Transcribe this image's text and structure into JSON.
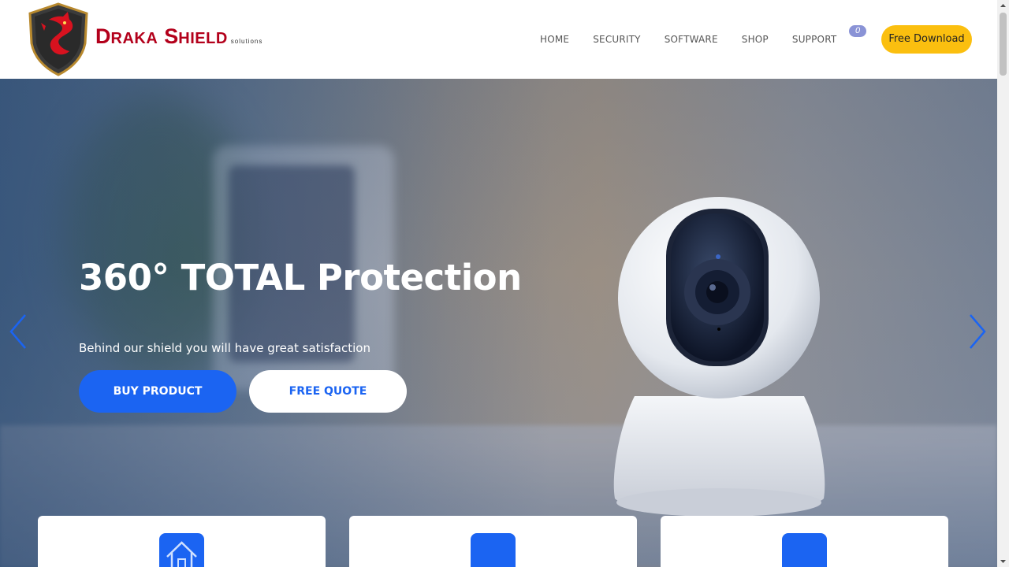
{
  "brand": {
    "first_initial": "D",
    "first_rest": "RAKA",
    "second_initial": "S",
    "second_rest": "HIELD",
    "suffix": "solutions"
  },
  "nav": {
    "items": [
      {
        "label": "HOME"
      },
      {
        "label": "SECURITY"
      },
      {
        "label": "SOFTWARE"
      },
      {
        "label": "SHOP"
      },
      {
        "label": "SUPPORT"
      }
    ],
    "cart_count": "0",
    "download_label": "Free Download"
  },
  "hero": {
    "headline": "360° TOTAL Protection",
    "tagline": "Behind our shield you will have great satisfaction",
    "buy_label": "BUY PRODUCT",
    "quote_label": "FREE QUOTE"
  },
  "icons": {
    "logo": "dragon-shield-logo",
    "prev": "chevron-left-icon",
    "next": "chevron-right-icon",
    "card_1": "home-icon"
  },
  "colors": {
    "accent": "#1b64f2",
    "download": "#fbbf0f",
    "brand": "#b3001b",
    "badge": "#8a93d6"
  }
}
